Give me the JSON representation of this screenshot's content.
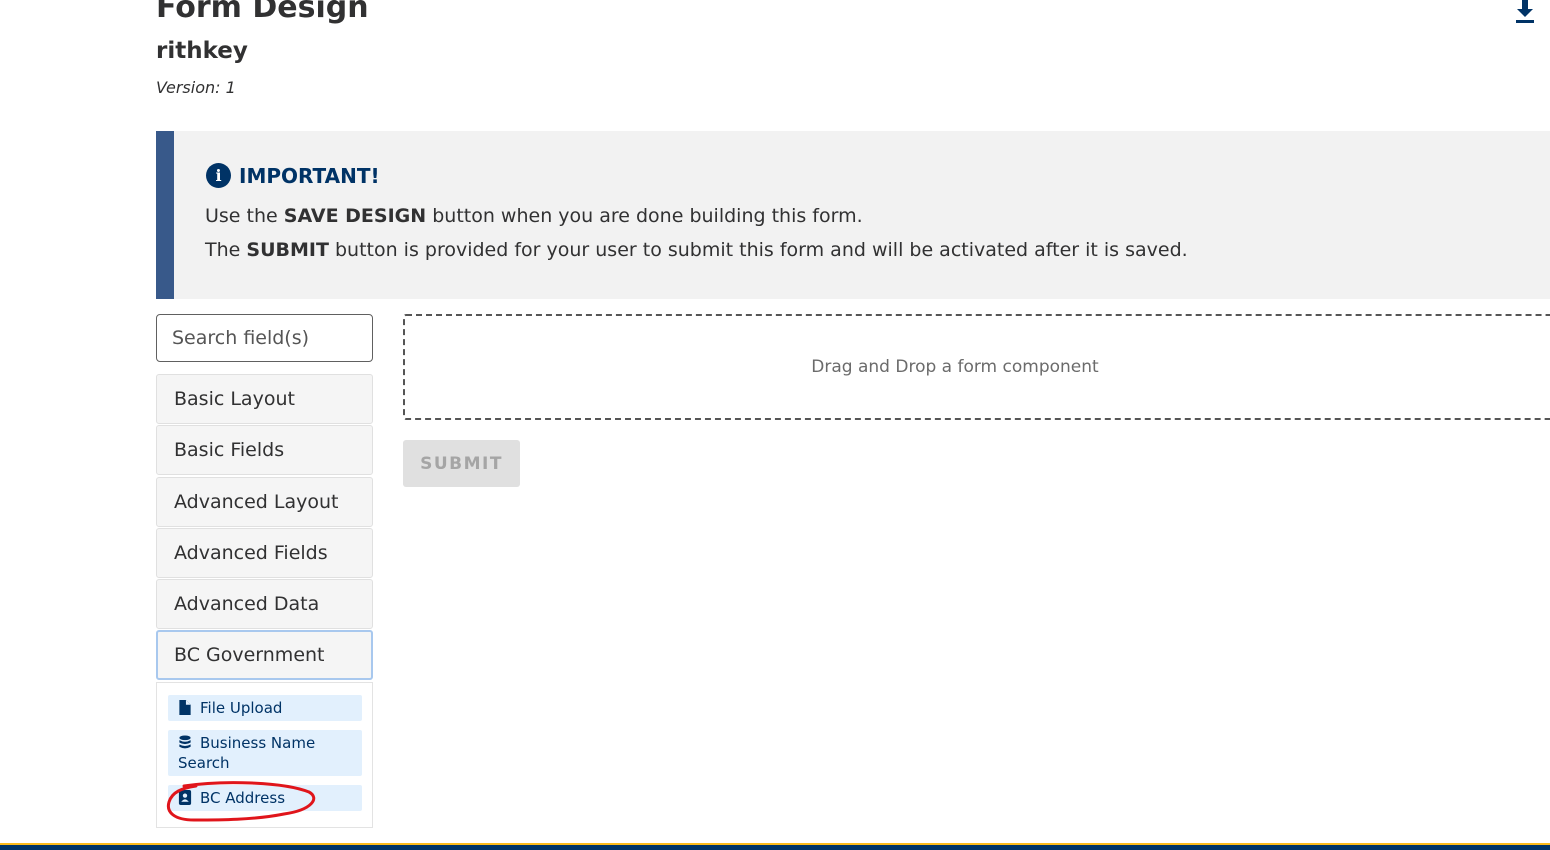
{
  "header": {
    "title": "Form Design",
    "subtitle": "rithkey",
    "version": "Version: 1",
    "download_icon": "download-icon"
  },
  "alert": {
    "icon": "info-icon",
    "title": "IMPORTANT!",
    "line1_pre": "Use the ",
    "line1_bold": "SAVE DESIGN",
    "line1_post": " button when you are done building this form.",
    "line2_pre": "The ",
    "line2_bold": "SUBMIT",
    "line2_post": " button is provided for your user to submit this form and will be activated after it is saved.",
    "accent_color": "#38598a"
  },
  "sidebar": {
    "search_placeholder": "Search field(s)",
    "categories": [
      {
        "label": "Basic Layout"
      },
      {
        "label": "Basic Fields"
      },
      {
        "label": "Advanced Layout"
      },
      {
        "label": "Advanced Fields"
      },
      {
        "label": "Advanced Data"
      },
      {
        "label": "BC Government",
        "active": true
      }
    ],
    "components": [
      {
        "label": "File Upload",
        "icon": "file-icon"
      },
      {
        "label": "Business Name Search",
        "icon": "database-icon"
      },
      {
        "label": "BC Address",
        "icon": "address-book-icon"
      }
    ]
  },
  "canvas": {
    "dropzone_text": "Drag and Drop a form component",
    "submit_label": "SUBMIT"
  },
  "colors": {
    "brand_navy": "#003366",
    "brand_gold": "#fcba19",
    "annotation_red": "#e0151b"
  }
}
